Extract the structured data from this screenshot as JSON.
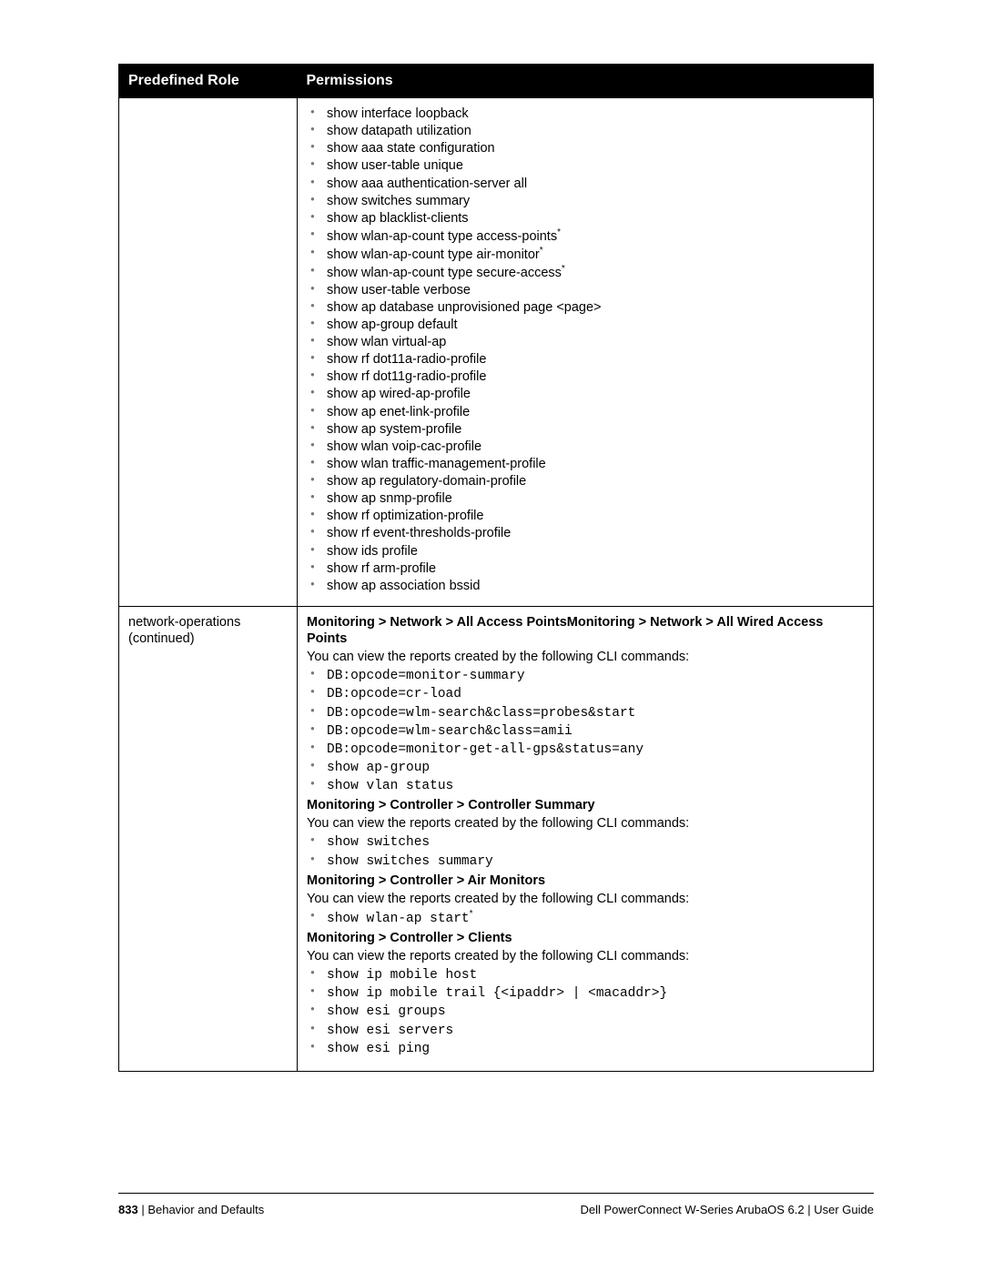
{
  "table": {
    "header": {
      "col1": "Predefined Role",
      "col2": "Permissions"
    },
    "row1": {
      "items": [
        {
          "t": "show interface loopback",
          "sup": false
        },
        {
          "t": "show datapath utilization",
          "sup": false
        },
        {
          "t": "show aaa state configuration",
          "sup": false
        },
        {
          "t": "show user-table unique",
          "sup": false
        },
        {
          "t": "show aaa authentication-server all",
          "sup": false
        },
        {
          "t": "show switches summary",
          "sup": false
        },
        {
          "t": "show ap blacklist-clients",
          "sup": false
        },
        {
          "t": "show wlan-ap-count type access-points",
          "sup": true
        },
        {
          "t": "show wlan-ap-count type air-monitor",
          "sup": true
        },
        {
          "t": "show wlan-ap-count type secure-access",
          "sup": true
        },
        {
          "t": "show user-table verbose",
          "sup": false
        },
        {
          "t": "show ap database unprovisioned page <page>",
          "sup": false
        },
        {
          "t": "show ap-group default",
          "sup": false
        },
        {
          "t": "show wlan virtual-ap",
          "sup": false
        },
        {
          "t": "show rf dot11a-radio-profile",
          "sup": false
        },
        {
          "t": "show rf dot11g-radio-profile",
          "sup": false
        },
        {
          "t": "show ap wired-ap-profile",
          "sup": false
        },
        {
          "t": "show ap enet-link-profile",
          "sup": false
        },
        {
          "t": "show ap system-profile",
          "sup": false
        },
        {
          "t": "show wlan voip-cac-profile",
          "sup": false
        },
        {
          "t": "show wlan traffic-management-profile",
          "sup": false
        },
        {
          "t": "show ap regulatory-domain-profile",
          "sup": false
        },
        {
          "t": "show ap snmp-profile",
          "sup": false
        },
        {
          "t": "show rf optimization-profile",
          "sup": false
        },
        {
          "t": "show rf event-thresholds-profile",
          "sup": false
        },
        {
          "t": "show ids profile",
          "sup": false
        },
        {
          "t": "show rf arm-profile",
          "sup": false
        },
        {
          "t": "show ap association bssid",
          "sup": false
        }
      ]
    },
    "row2": {
      "role": "network-operations (continued)",
      "sections": [
        {
          "heading": "Monitoring > Network > All Access PointsMonitoring > Network > All Wired Access Points",
          "intro": "You can view the reports created by the following CLI commands:",
          "items": [
            {
              "t": "DB:opcode=monitor-summary",
              "mono": true
            },
            {
              "t": "DB:opcode=cr-load",
              "mono": true
            },
            {
              "t": "DB:opcode=wlm-search&class=probes&start",
              "mono": true
            },
            {
              "t": "DB:opcode=wlm-search&class=amii",
              "mono": true
            },
            {
              "t": "DB:opcode=monitor-get-all-gps&status=any",
              "mono": true
            },
            {
              "t": "show ap-group",
              "mono": true
            },
            {
              "t": "show vlan status",
              "mono": true
            }
          ]
        },
        {
          "heading": "Monitoring > Controller > Controller Summary",
          "intro": "You can view the reports created by the following CLI commands:",
          "items": [
            {
              "t": "show switches",
              "mono": true
            },
            {
              "t": "show switches summary",
              "mono": true
            }
          ]
        },
        {
          "heading": "Monitoring > Controller > Air Monitors",
          "intro": "You can view the reports created by the following CLI commands:",
          "items": [
            {
              "t": "show wlan-ap start",
              "mono": true,
              "sup": true
            }
          ]
        },
        {
          "heading": "Monitoring > Controller > Clients",
          "intro": "You can view the reports created by the following CLI commands:",
          "items": [
            {
              "t": "show ip mobile host",
              "mono": true
            },
            {
              "t": "show ip mobile trail {<ipaddr> | <macaddr>}",
              "mono": true
            },
            {
              "t": "show esi groups",
              "mono": true
            },
            {
              "t": "show esi servers",
              "mono": true
            },
            {
              "t": "show esi ping",
              "mono": true
            }
          ]
        }
      ]
    }
  },
  "footer": {
    "page": "833",
    "sep": " | ",
    "section": "Behavior and Defaults",
    "product": "Dell PowerConnect W-Series ArubaOS 6.2",
    "doc": "User Guide"
  }
}
